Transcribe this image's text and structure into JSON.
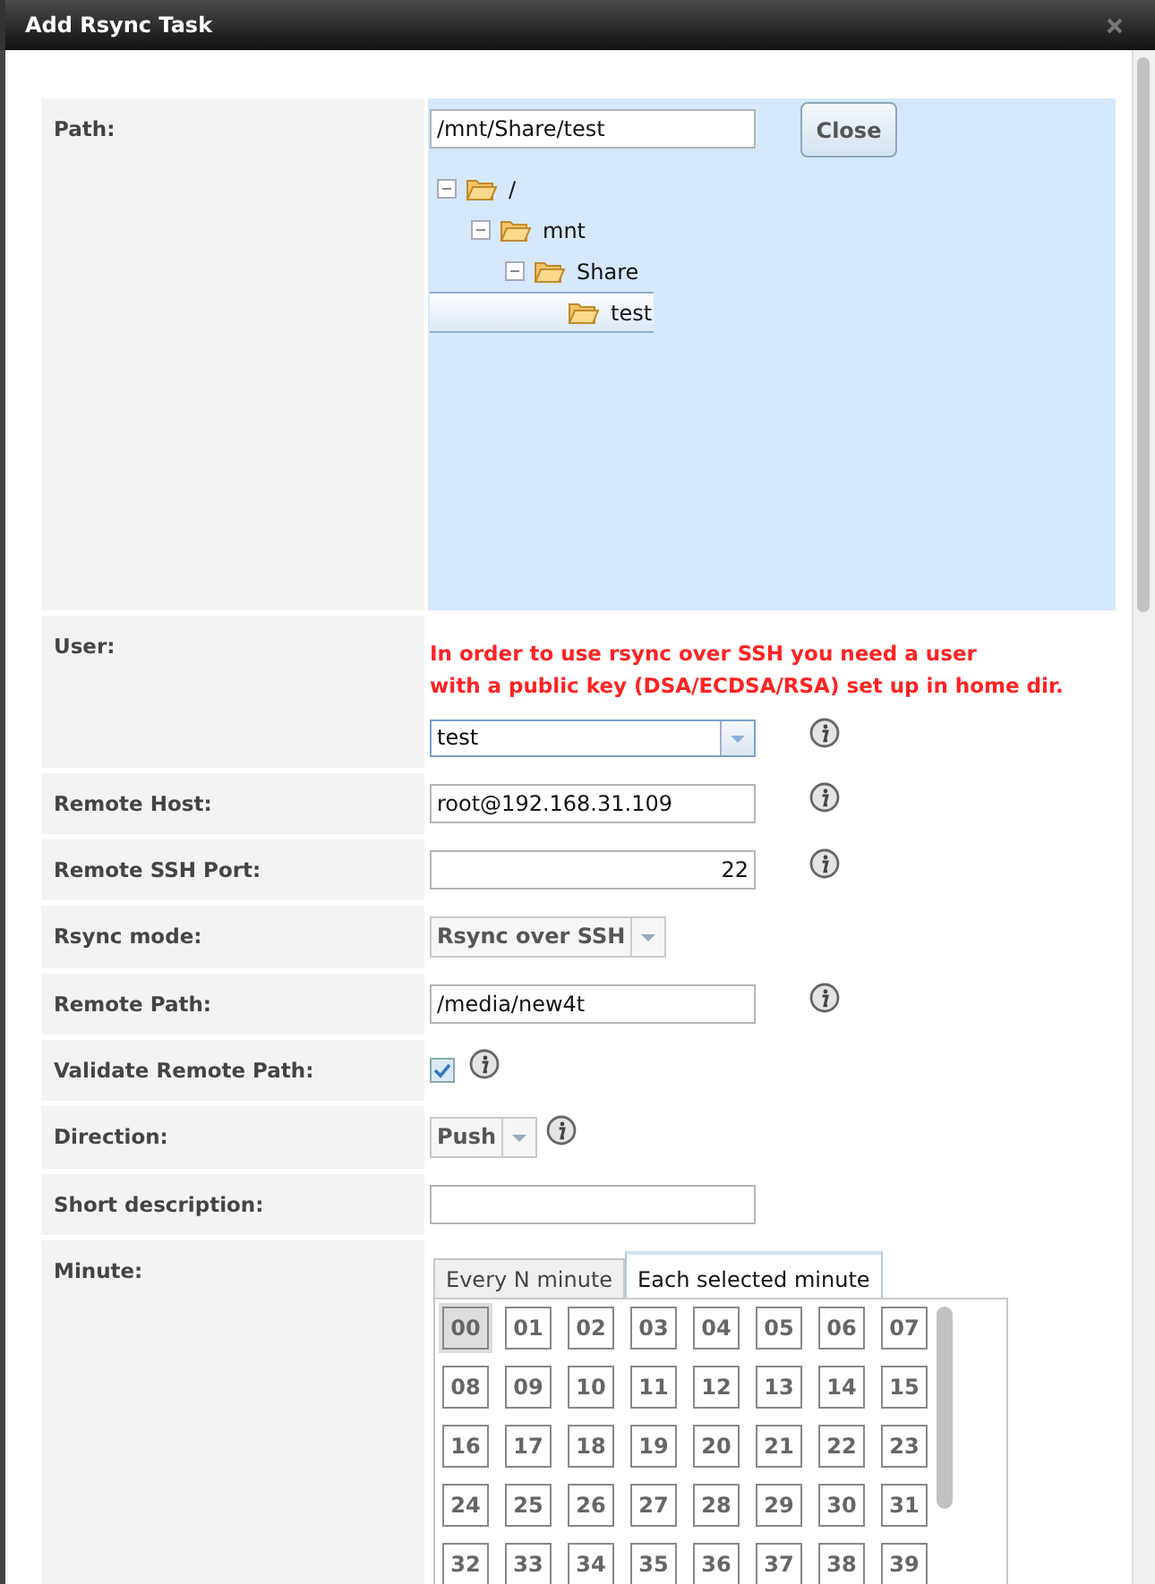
{
  "dialog": {
    "title": "Add Rsync Task"
  },
  "fields": [
    {
      "kind": "path",
      "label": "Path:",
      "value": "/mnt/Share/test",
      "button": "Close",
      "tree": [
        {
          "label": "/",
          "expanded": true,
          "selected": false,
          "children": [
            {
              "label": "mnt",
              "expanded": true,
              "selected": false,
              "children": [
                {
                  "label": "Share",
                  "expanded": true,
                  "selected": false,
                  "children": [
                    {
                      "label": "test",
                      "selected": true
                    }
                  ]
                }
              ]
            }
          ]
        }
      ]
    },
    {
      "kind": "combo",
      "label": "User:",
      "warning": "In order to use rsync over SSH you need a user\nwith a public key (DSA/ECDSA/RSA) set up in home dir.",
      "value": "test",
      "info": true
    },
    {
      "kind": "text",
      "label": "Remote Host:",
      "value": "root@192.168.31.109",
      "info": true
    },
    {
      "kind": "number",
      "label": "Remote SSH Port:",
      "value": "22",
      "info": true
    },
    {
      "kind": "dropdown",
      "label": "Rsync mode:",
      "value": "Rsync over SSH",
      "info": false
    },
    {
      "kind": "text",
      "label": "Remote Path:",
      "value": "/media/new4t",
      "info": true
    },
    {
      "kind": "checkbox",
      "label": "Validate Remote Path:",
      "checked": true,
      "info": true
    },
    {
      "kind": "dropdown",
      "label": "Direction:",
      "value": "Push",
      "info": true
    },
    {
      "kind": "text",
      "label": "Short description:",
      "info": false
    },
    {
      "kind": "minute",
      "label": "Minute:",
      "tabs": [
        {
          "label": "Every N minute",
          "selected": false
        },
        {
          "label": "Each selected minute",
          "selected": true
        }
      ],
      "minutes": [
        {
          "label": "00",
          "selected": true
        },
        {
          "label": "01",
          "selected": false
        },
        {
          "label": "02",
          "selected": false
        },
        {
          "label": "03",
          "selected": false
        },
        {
          "label": "04",
          "selected": false
        },
        {
          "label": "05",
          "selected": false
        },
        {
          "label": "06",
          "selected": false
        },
        {
          "label": "07",
          "selected": false
        },
        {
          "label": "08",
          "selected": false
        },
        {
          "label": "09",
          "selected": false
        },
        {
          "label": "10",
          "selected": false
        },
        {
          "label": "11",
          "selected": false
        },
        {
          "label": "12",
          "selected": false
        },
        {
          "label": "13",
          "selected": false
        },
        {
          "label": "14",
          "selected": false
        },
        {
          "label": "15",
          "selected": false
        },
        {
          "label": "16",
          "selected": false
        },
        {
          "label": "17",
          "selected": false
        },
        {
          "label": "18",
          "selected": false
        },
        {
          "label": "19",
          "selected": false
        },
        {
          "label": "20",
          "selected": false
        },
        {
          "label": "21",
          "selected": false
        },
        {
          "label": "22",
          "selected": false
        },
        {
          "label": "23",
          "selected": false
        },
        {
          "label": "24",
          "selected": false
        },
        {
          "label": "25",
          "selected": false
        },
        {
          "label": "26",
          "selected": false
        },
        {
          "label": "27",
          "selected": false
        },
        {
          "label": "28",
          "selected": false
        },
        {
          "label": "29",
          "selected": false
        },
        {
          "label": "30",
          "selected": false
        },
        {
          "label": "31",
          "selected": false
        },
        {
          "label": "32",
          "selected": false
        },
        {
          "label": "33",
          "selected": false
        },
        {
          "label": "34",
          "selected": false
        },
        {
          "label": "35",
          "selected": false
        },
        {
          "label": "36",
          "selected": false
        },
        {
          "label": "37",
          "selected": false
        },
        {
          "label": "38",
          "selected": false
        },
        {
          "label": "39",
          "selected": false
        }
      ]
    }
  ]
}
